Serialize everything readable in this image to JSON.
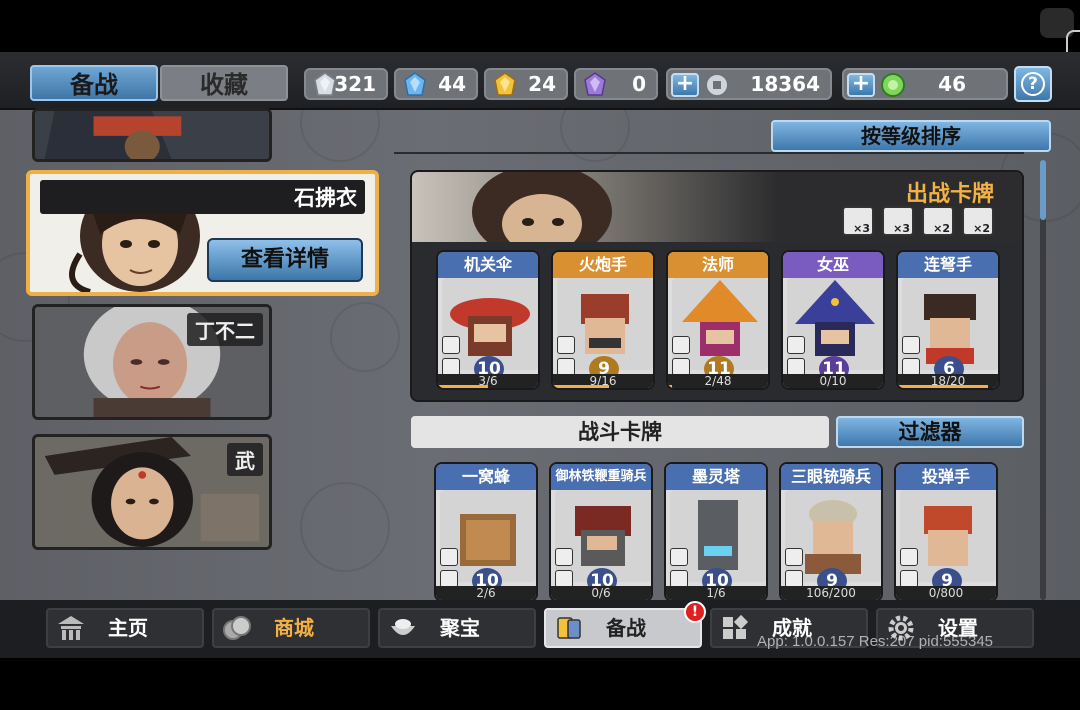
{
  "tabs": {
    "active": "备战",
    "inactive": "收藏"
  },
  "resources": [
    {
      "name": "silver-crystal",
      "value": "321",
      "color": "#d8dde4"
    },
    {
      "name": "blue-crystal",
      "value": "44",
      "color": "#6cb6f0"
    },
    {
      "name": "gold-crystal",
      "value": "24",
      "color": "#f2c23a"
    },
    {
      "name": "purple-crystal",
      "value": "0",
      "color": "#9b7ad9"
    }
  ],
  "currency": {
    "coins": "18364",
    "gems": "46",
    "plus": "+"
  },
  "help_label": "?",
  "heroes": [
    {
      "name": "石拂衣",
      "selected": true,
      "detail_label": "查看详情"
    },
    {
      "name": "丁不二",
      "selected": false
    },
    {
      "name": "武",
      "selected": false
    }
  ],
  "sort_label": "按等级排序",
  "deck": {
    "title": "出战卡牌",
    "costs": [
      "×3",
      "×3",
      "×2",
      "×2"
    ],
    "cards": [
      {
        "name": "机关伞",
        "level": "10",
        "progress": "3/6",
        "fill": 0.5,
        "color": "#4a6fb0"
      },
      {
        "name": "火炮手",
        "level": "9",
        "progress": "9/16",
        "fill": 0.56,
        "color": "#d99030"
      },
      {
        "name": "法师",
        "level": "11",
        "progress": "2/48",
        "fill": 0.04,
        "color": "#d99030"
      },
      {
        "name": "女巫",
        "level": "11",
        "progress": "0/10",
        "fill": 0.0,
        "color": "#7a5bc0"
      },
      {
        "name": "连弩手",
        "level": "6",
        "progress": "18/20",
        "fill": 0.9,
        "color": "#4a6fb0"
      }
    ]
  },
  "battle_cards_label": "战斗卡牌",
  "filter_label": "过滤器",
  "battle_cards": [
    {
      "name": "一窝蜂",
      "level": "10",
      "progress": "2/6",
      "color": "#4a6fb0"
    },
    {
      "name": "御林铁鞭重骑兵",
      "level": "10",
      "progress": "0/6",
      "color": "#4a6fb0"
    },
    {
      "name": "墨灵塔",
      "level": "10",
      "progress": "1/6",
      "color": "#4a6fb0"
    },
    {
      "name": "三眼铳骑兵",
      "level": "9",
      "progress": "106/200",
      "color": "#4a6fb0"
    },
    {
      "name": "投弹手",
      "level": "9",
      "progress": "0/800",
      "color": "#4a6fb0"
    }
  ],
  "nav": [
    {
      "label": "主页",
      "icon": "temple-icon"
    },
    {
      "label": "商城",
      "icon": "coins-icon"
    },
    {
      "label": "聚宝",
      "icon": "treasure-bowl-icon"
    },
    {
      "label": "备战",
      "icon": "cards-icon",
      "active": true
    },
    {
      "label": "成就",
      "icon": "grid-icon"
    },
    {
      "label": "设置",
      "icon": "gear-icon"
    }
  ],
  "alert_label": "!",
  "version_text": "App: 1.0.0.157 Res:207 pid:555345"
}
